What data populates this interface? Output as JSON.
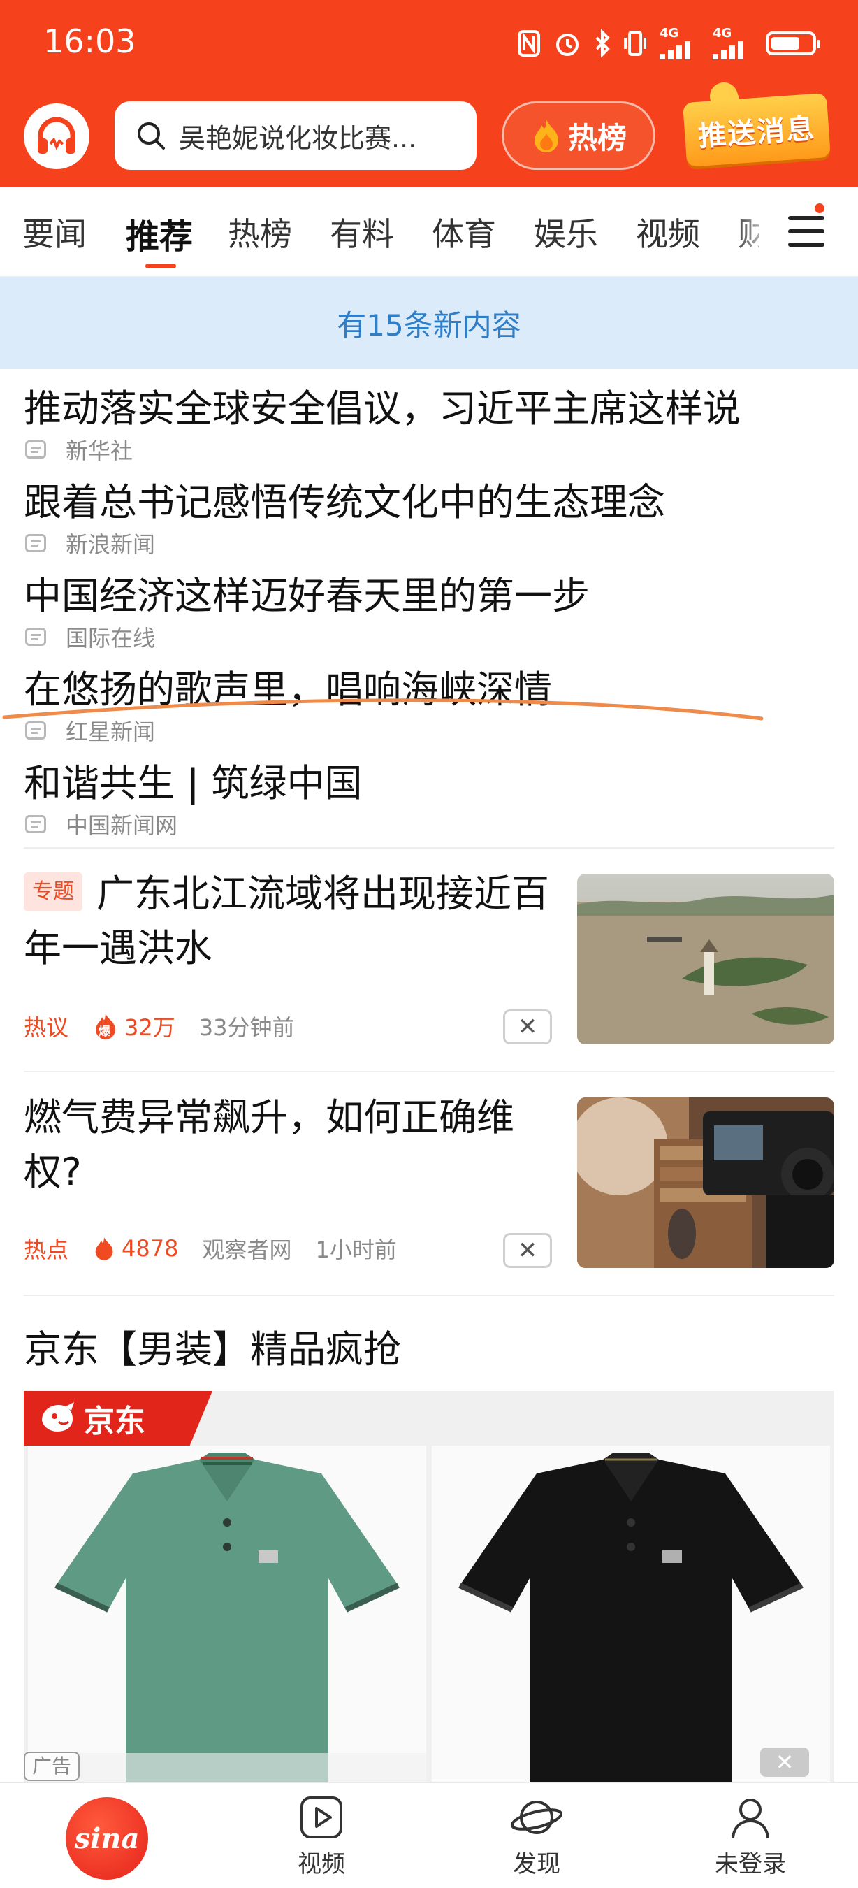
{
  "status_bar": {
    "time": "16:03",
    "signal_a": "4G",
    "signal_b": "4G"
  },
  "header": {
    "search_placeholder": "吴艳妮说化妆比赛...",
    "hot_label": "热榜",
    "push_label": "推送消息"
  },
  "tabs": [
    "要闻",
    "推荐",
    "热榜",
    "有料",
    "体育",
    "娱乐",
    "视频",
    "财"
  ],
  "active_tab": "推荐",
  "banner": "有15条新内容",
  "headlines": [
    {
      "title": "推动落实全球安全倡议，习近平主席这样说",
      "source": "新华社"
    },
    {
      "title": "跟着总书记感悟传统文化中的生态理念",
      "source": "新浪新闻"
    },
    {
      "title": "中国经济这样迈好春天里的第一步",
      "source": "国际在线"
    },
    {
      "title": "在悠扬的歌声里，唱响海峡深情",
      "source": "红星新闻"
    },
    {
      "title": "和谐共生 | 筑绿中国",
      "source": "中国新闻网"
    }
  ],
  "articles": [
    {
      "tag": "专题",
      "title": "广东北江流域将出现接近百年一遇洪水",
      "meta_tag": "热议",
      "badge": "爆",
      "count": "32万",
      "time": "33分钟前",
      "close": "✕"
    },
    {
      "title": "燃气费异常飙升，如何正确维权?",
      "meta_tag": "热点",
      "count": "4878",
      "source": "观察者网",
      "time": "1小时前",
      "close": "✕"
    }
  ],
  "ad": {
    "title": "京东【男装】精品疯抢",
    "brand": "京东",
    "label": "广告",
    "close": "✕"
  },
  "bottom_nav": {
    "home_logo": "sina",
    "video": "视频",
    "discover": "发现",
    "profile": "未登录"
  },
  "colors": {
    "accent": "#f5421d",
    "banner_bg": "#dcebfa",
    "banner_text": "#2e7ec8",
    "hot_text": "#f04a22"
  }
}
